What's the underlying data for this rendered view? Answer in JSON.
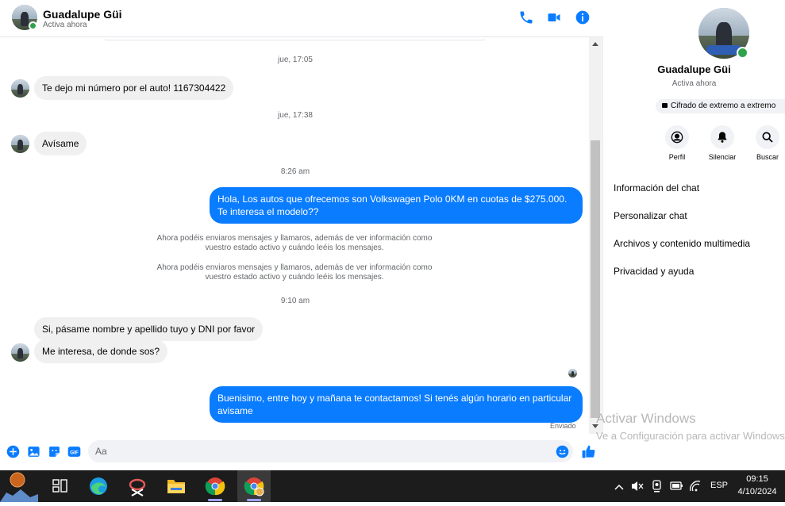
{
  "contact": {
    "name": "Guadalupe Güi",
    "status": "Activa ahora"
  },
  "header": {
    "icons": [
      "phone-icon",
      "video-icon",
      "info-icon"
    ]
  },
  "colors": {
    "accent": "#0a7cff",
    "incoming_bubble": "#f0f0f0",
    "online": "#31a24c"
  },
  "messages": {
    "t1": "jue, 17:05",
    "m1": "Te dejo mi número por el auto! 1167304422",
    "t2": "jue, 17:38",
    "m2": "Avísame",
    "t3": "8:26 am",
    "m3": "Hola, Los autos que ofrecemos son Volkswagen Polo 0KM en cuotas de $275.000. Te interesa el modelo??",
    "sys1": "Ahora podéis enviaros mensajes y llamaros, además de ver información como vuestro estado activo y cuándo leéis los mensajes.",
    "sys2": "Ahora podéis enviaros mensajes y llamaros, además de ver información como vuestro estado activo y cuándo leéis los mensajes.",
    "t4": "9:10 am",
    "m4": "Si, pásame nombre y apellido tuyo y DNI por favor",
    "m5": "Me interesa, de donde sos?",
    "m6": "Buenisimo, entre hoy y mañana te contactamos! Si tenés algún horario en particular avisame",
    "sent_status": "Enviado"
  },
  "composer": {
    "placeholder": "Aa",
    "icons": [
      "plus-icon",
      "photo-icon",
      "sticker-icon",
      "gif-icon",
      "emoji-icon",
      "thumbs-up-icon"
    ],
    "gif_label": "GIF"
  },
  "side": {
    "name": "Guadalupe Güi",
    "status": "Activa ahora",
    "encryption": "Cifrado de extremo a extremo",
    "actions": [
      {
        "label": "Perfil",
        "icon": "profile-icon"
      },
      {
        "label": "Silenciar",
        "icon": "bell-icon"
      },
      {
        "label": "Buscar",
        "icon": "search-icon"
      }
    ],
    "menu": [
      "Información del chat",
      "Personalizar chat",
      "Archivos y contenido multimedia",
      "Privacidad y ayuda"
    ]
  },
  "watermark": {
    "line1": "Activar Windows",
    "line2": "Ve a Configuración para activar Windows."
  },
  "taskbar": {
    "apps": [
      "weather-icon",
      "task-view-icon",
      "edge-icon",
      "snipping-tool-icon",
      "file-explorer-icon",
      "chrome-icon",
      "chrome-profile-icon"
    ],
    "language": "ESP",
    "time": "09:15",
    "date": "4/10/2024"
  }
}
